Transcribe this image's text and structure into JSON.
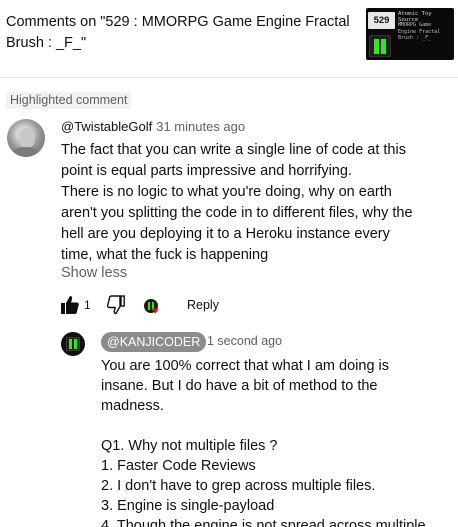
{
  "header": {
    "title": "Comments on \"529 : MMORPG Game Engine Fractal Brush : _F_\"",
    "thumbnail": {
      "number": "529",
      "title": "Atomic Toy Source",
      "subtitle": "MMORPG Game Engine Fractal Brush : _F_",
      "logo_color": "#2eea1f"
    }
  },
  "highlighted_label": "Highlighted comment",
  "comment": {
    "author": "@TwistableGolf",
    "time": "31 minutes ago",
    "paragraphs": [
      "The fact that you can write a single line of code at this point is equal parts impressive and horrifying.",
      "There is no logic to what you're doing, why on earth aren't you splitting the code in to different files, why the hell are you deploying it to a Heroku instance every time, what the fuck is happening"
    ],
    "show_less": "Show less",
    "like_count": "1",
    "reply_label": "Reply",
    "heart_color": "#ff0000"
  },
  "reply": {
    "author": "@KANJICODER",
    "time": "1 second ago",
    "lines": [
      "You are 100% correct that what I am doing is insane. But I do have a bit of method to the madness.",
      "",
      "Q1. Why not multiple files ?",
      "1. Faster Code Reviews",
      "2. I don't have to grep across multiple files.",
      "3. Engine is single-payload",
      "4. Though the engine is not spread across multiple"
    ]
  },
  "icons": [
    "thumbs-up-icon",
    "thumbs-down-icon",
    "heart-icon"
  ]
}
